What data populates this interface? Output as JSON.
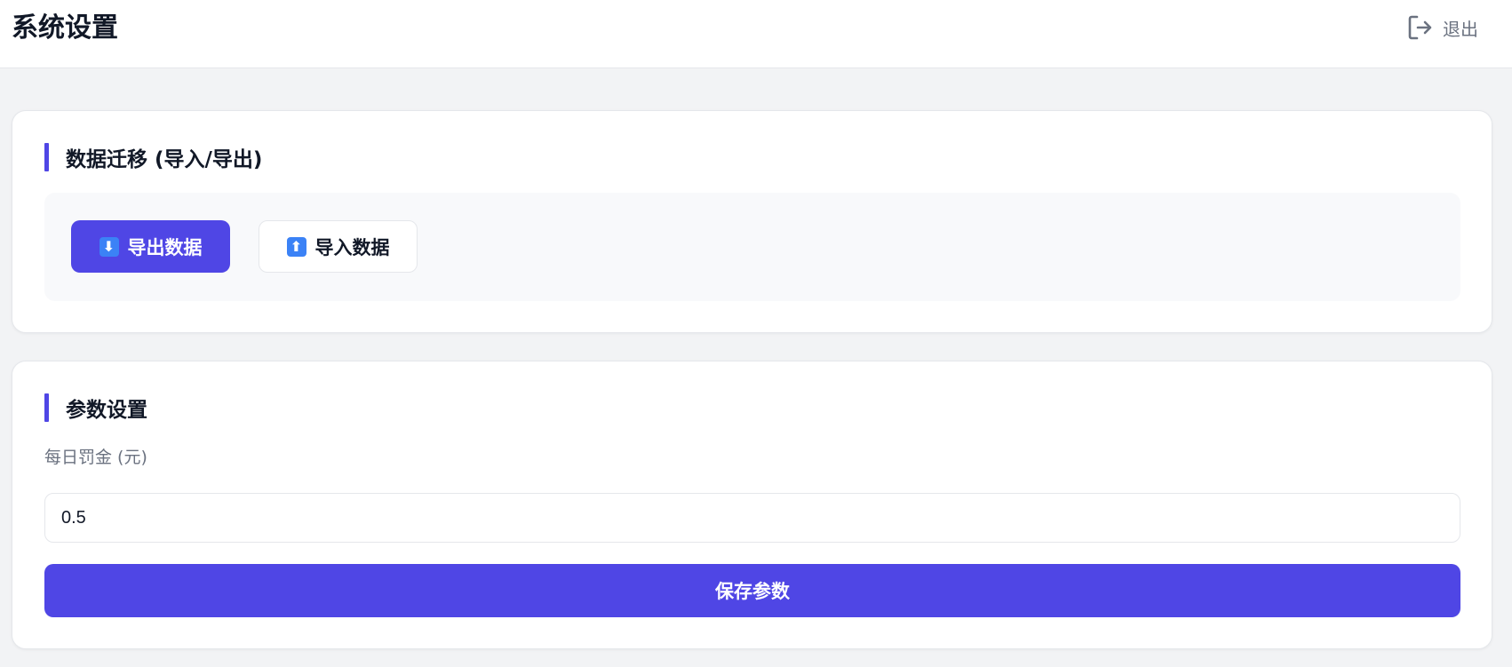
{
  "header": {
    "title": "系统设置",
    "logout_label": "退出",
    "logout_icon": "logout-icon"
  },
  "migration": {
    "title": "数据迁移 (导入/导出)",
    "export_label": "导出数据",
    "export_icon": "⬇",
    "import_label": "导入数据",
    "import_icon": "⬆"
  },
  "params": {
    "title": "参数设置",
    "fine_label": "每日罚金 (元)",
    "fine_value": "0.5",
    "save_label": "保存参数"
  },
  "colors": {
    "accent": "#4f46e5",
    "page_bg": "#f2f3f5",
    "muted_text": "#6b7280"
  }
}
